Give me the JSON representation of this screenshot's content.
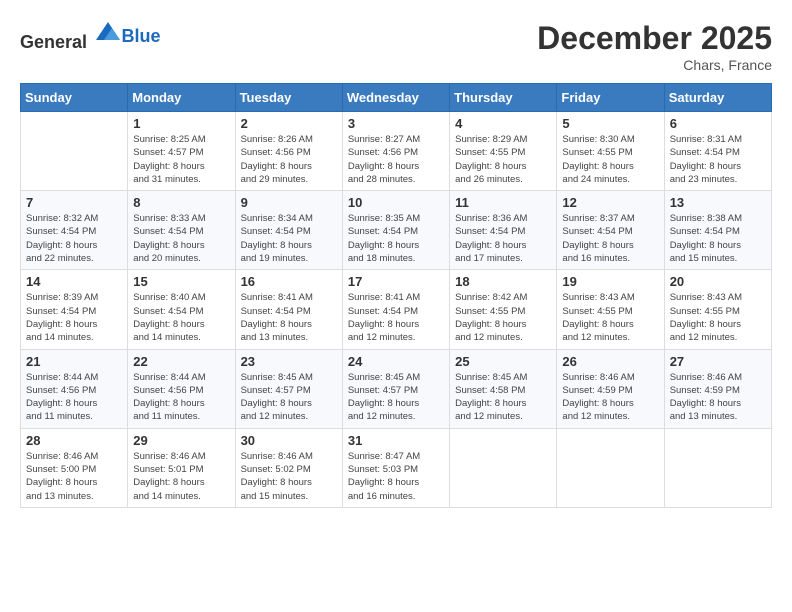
{
  "header": {
    "logo_general": "General",
    "logo_blue": "Blue",
    "month_title": "December 2025",
    "location": "Chars, France"
  },
  "weekdays": [
    "Sunday",
    "Monday",
    "Tuesday",
    "Wednesday",
    "Thursday",
    "Friday",
    "Saturday"
  ],
  "weeks": [
    [
      {
        "day": "",
        "info": ""
      },
      {
        "day": "1",
        "info": "Sunrise: 8:25 AM\nSunset: 4:57 PM\nDaylight: 8 hours\nand 31 minutes."
      },
      {
        "day": "2",
        "info": "Sunrise: 8:26 AM\nSunset: 4:56 PM\nDaylight: 8 hours\nand 29 minutes."
      },
      {
        "day": "3",
        "info": "Sunrise: 8:27 AM\nSunset: 4:56 PM\nDaylight: 8 hours\nand 28 minutes."
      },
      {
        "day": "4",
        "info": "Sunrise: 8:29 AM\nSunset: 4:55 PM\nDaylight: 8 hours\nand 26 minutes."
      },
      {
        "day": "5",
        "info": "Sunrise: 8:30 AM\nSunset: 4:55 PM\nDaylight: 8 hours\nand 24 minutes."
      },
      {
        "day": "6",
        "info": "Sunrise: 8:31 AM\nSunset: 4:54 PM\nDaylight: 8 hours\nand 23 minutes."
      }
    ],
    [
      {
        "day": "7",
        "info": "Sunrise: 8:32 AM\nSunset: 4:54 PM\nDaylight: 8 hours\nand 22 minutes."
      },
      {
        "day": "8",
        "info": "Sunrise: 8:33 AM\nSunset: 4:54 PM\nDaylight: 8 hours\nand 20 minutes."
      },
      {
        "day": "9",
        "info": "Sunrise: 8:34 AM\nSunset: 4:54 PM\nDaylight: 8 hours\nand 19 minutes."
      },
      {
        "day": "10",
        "info": "Sunrise: 8:35 AM\nSunset: 4:54 PM\nDaylight: 8 hours\nand 18 minutes."
      },
      {
        "day": "11",
        "info": "Sunrise: 8:36 AM\nSunset: 4:54 PM\nDaylight: 8 hours\nand 17 minutes."
      },
      {
        "day": "12",
        "info": "Sunrise: 8:37 AM\nSunset: 4:54 PM\nDaylight: 8 hours\nand 16 minutes."
      },
      {
        "day": "13",
        "info": "Sunrise: 8:38 AM\nSunset: 4:54 PM\nDaylight: 8 hours\nand 15 minutes."
      }
    ],
    [
      {
        "day": "14",
        "info": "Sunrise: 8:39 AM\nSunset: 4:54 PM\nDaylight: 8 hours\nand 14 minutes."
      },
      {
        "day": "15",
        "info": "Sunrise: 8:40 AM\nSunset: 4:54 PM\nDaylight: 8 hours\nand 14 minutes."
      },
      {
        "day": "16",
        "info": "Sunrise: 8:41 AM\nSunset: 4:54 PM\nDaylight: 8 hours\nand 13 minutes."
      },
      {
        "day": "17",
        "info": "Sunrise: 8:41 AM\nSunset: 4:54 PM\nDaylight: 8 hours\nand 12 minutes."
      },
      {
        "day": "18",
        "info": "Sunrise: 8:42 AM\nSunset: 4:55 PM\nDaylight: 8 hours\nand 12 minutes."
      },
      {
        "day": "19",
        "info": "Sunrise: 8:43 AM\nSunset: 4:55 PM\nDaylight: 8 hours\nand 12 minutes."
      },
      {
        "day": "20",
        "info": "Sunrise: 8:43 AM\nSunset: 4:55 PM\nDaylight: 8 hours\nand 12 minutes."
      }
    ],
    [
      {
        "day": "21",
        "info": "Sunrise: 8:44 AM\nSunset: 4:56 PM\nDaylight: 8 hours\nand 11 minutes."
      },
      {
        "day": "22",
        "info": "Sunrise: 8:44 AM\nSunset: 4:56 PM\nDaylight: 8 hours\nand 11 minutes."
      },
      {
        "day": "23",
        "info": "Sunrise: 8:45 AM\nSunset: 4:57 PM\nDaylight: 8 hours\nand 12 minutes."
      },
      {
        "day": "24",
        "info": "Sunrise: 8:45 AM\nSunset: 4:57 PM\nDaylight: 8 hours\nand 12 minutes."
      },
      {
        "day": "25",
        "info": "Sunrise: 8:45 AM\nSunset: 4:58 PM\nDaylight: 8 hours\nand 12 minutes."
      },
      {
        "day": "26",
        "info": "Sunrise: 8:46 AM\nSunset: 4:59 PM\nDaylight: 8 hours\nand 12 minutes."
      },
      {
        "day": "27",
        "info": "Sunrise: 8:46 AM\nSunset: 4:59 PM\nDaylight: 8 hours\nand 13 minutes."
      }
    ],
    [
      {
        "day": "28",
        "info": "Sunrise: 8:46 AM\nSunset: 5:00 PM\nDaylight: 8 hours\nand 13 minutes."
      },
      {
        "day": "29",
        "info": "Sunrise: 8:46 AM\nSunset: 5:01 PM\nDaylight: 8 hours\nand 14 minutes."
      },
      {
        "day": "30",
        "info": "Sunrise: 8:46 AM\nSunset: 5:02 PM\nDaylight: 8 hours\nand 15 minutes."
      },
      {
        "day": "31",
        "info": "Sunrise: 8:47 AM\nSunset: 5:03 PM\nDaylight: 8 hours\nand 16 minutes."
      },
      {
        "day": "",
        "info": ""
      },
      {
        "day": "",
        "info": ""
      },
      {
        "day": "",
        "info": ""
      }
    ]
  ]
}
